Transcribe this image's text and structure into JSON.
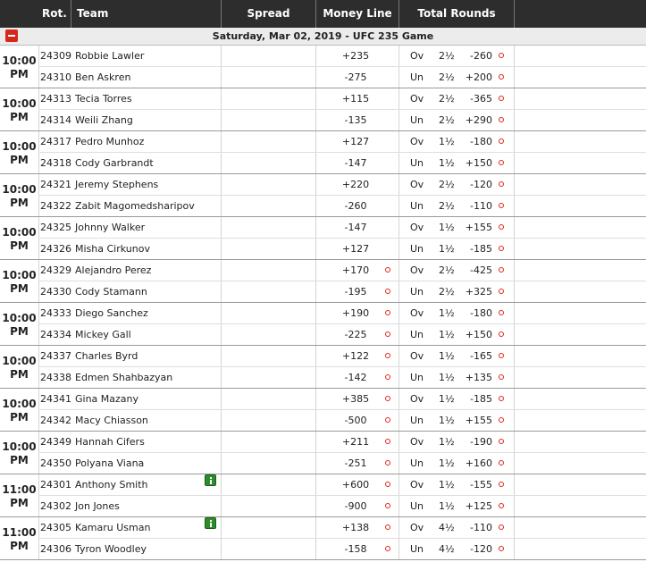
{
  "header": {
    "rot": "Rot.",
    "team": "Team",
    "spread": "Spread",
    "moneyline": "Money Line",
    "total": "Total Rounds"
  },
  "event_title": "Saturday, Mar 02, 2019 - UFC 235 Game",
  "colors": {
    "header_bg": "#2d2d2d",
    "date_band_bg": "#ececec",
    "accent_red": "#e0261a",
    "info_green": "#2e8c2e"
  },
  "icons": {
    "collapse": "minus-square-icon",
    "bet": "circle-bet-icon",
    "info": "info-icon"
  },
  "games": [
    {
      "time": [
        "10:00",
        "PM"
      ],
      "info": false,
      "ml_clickable": false,
      "fighters": [
        {
          "rot": "24309",
          "name": "Robbie Lawler",
          "ml": "+235",
          "ou": "Ov",
          "total": "2½",
          "odds": "-260"
        },
        {
          "rot": "24310",
          "name": "Ben Askren",
          "ml": "-275",
          "ou": "Un",
          "total": "2½",
          "odds": "+200"
        }
      ]
    },
    {
      "time": [
        "10:00",
        "PM"
      ],
      "info": false,
      "ml_clickable": false,
      "fighters": [
        {
          "rot": "24313",
          "name": "Tecia Torres",
          "ml": "+115",
          "ou": "Ov",
          "total": "2½",
          "odds": "-365"
        },
        {
          "rot": "24314",
          "name": "Weili Zhang",
          "ml": "-135",
          "ou": "Un",
          "total": "2½",
          "odds": "+290"
        }
      ]
    },
    {
      "time": [
        "10:00",
        "PM"
      ],
      "info": false,
      "ml_clickable": false,
      "fighters": [
        {
          "rot": "24317",
          "name": "Pedro Munhoz",
          "ml": "+127",
          "ou": "Ov",
          "total": "1½",
          "odds": "-180"
        },
        {
          "rot": "24318",
          "name": "Cody Garbrandt",
          "ml": "-147",
          "ou": "Un",
          "total": "1½",
          "odds": "+150"
        }
      ]
    },
    {
      "time": [
        "10:00",
        "PM"
      ],
      "info": false,
      "ml_clickable": false,
      "fighters": [
        {
          "rot": "24321",
          "name": "Jeremy Stephens",
          "ml": "+220",
          "ou": "Ov",
          "total": "2½",
          "odds": "-120"
        },
        {
          "rot": "24322",
          "name": "Zabit Magomedsharipov",
          "ml": "-260",
          "ou": "Un",
          "total": "2½",
          "odds": "-110"
        }
      ]
    },
    {
      "time": [
        "10:00",
        "PM"
      ],
      "info": false,
      "ml_clickable": false,
      "fighters": [
        {
          "rot": "24325",
          "name": "Johnny Walker",
          "ml": "-147",
          "ou": "Ov",
          "total": "1½",
          "odds": "+155"
        },
        {
          "rot": "24326",
          "name": "Misha Cirkunov",
          "ml": "+127",
          "ou": "Un",
          "total": "1½",
          "odds": "-185"
        }
      ]
    },
    {
      "time": [
        "10:00",
        "PM"
      ],
      "info": false,
      "ml_clickable": true,
      "fighters": [
        {
          "rot": "24329",
          "name": "Alejandro Perez",
          "ml": "+170",
          "ou": "Ov",
          "total": "2½",
          "odds": "-425"
        },
        {
          "rot": "24330",
          "name": "Cody Stamann",
          "ml": "-195",
          "ou": "Un",
          "total": "2½",
          "odds": "+325"
        }
      ]
    },
    {
      "time": [
        "10:00",
        "PM"
      ],
      "info": false,
      "ml_clickable": true,
      "fighters": [
        {
          "rot": "24333",
          "name": "Diego Sanchez",
          "ml": "+190",
          "ou": "Ov",
          "total": "1½",
          "odds": "-180"
        },
        {
          "rot": "24334",
          "name": "Mickey Gall",
          "ml": "-225",
          "ou": "Un",
          "total": "1½",
          "odds": "+150"
        }
      ]
    },
    {
      "time": [
        "10:00",
        "PM"
      ],
      "info": false,
      "ml_clickable": true,
      "fighters": [
        {
          "rot": "24337",
          "name": "Charles Byrd",
          "ml": "+122",
          "ou": "Ov",
          "total": "1½",
          "odds": "-165"
        },
        {
          "rot": "24338",
          "name": "Edmen Shahbazyan",
          "ml": "-142",
          "ou": "Un",
          "total": "1½",
          "odds": "+135"
        }
      ]
    },
    {
      "time": [
        "10:00",
        "PM"
      ],
      "info": false,
      "ml_clickable": true,
      "fighters": [
        {
          "rot": "24341",
          "name": "Gina Mazany",
          "ml": "+385",
          "ou": "Ov",
          "total": "1½",
          "odds": "-185"
        },
        {
          "rot": "24342",
          "name": "Macy Chiasson",
          "ml": "-500",
          "ou": "Un",
          "total": "1½",
          "odds": "+155"
        }
      ]
    },
    {
      "time": [
        "10:00",
        "PM"
      ],
      "info": false,
      "ml_clickable": true,
      "fighters": [
        {
          "rot": "24349",
          "name": "Hannah Cifers",
          "ml": "+211",
          "ou": "Ov",
          "total": "1½",
          "odds": "-190"
        },
        {
          "rot": "24350",
          "name": "Polyana Viana",
          "ml": "-251",
          "ou": "Un",
          "total": "1½",
          "odds": "+160"
        }
      ]
    },
    {
      "time": [
        "11:00",
        "PM"
      ],
      "info": true,
      "ml_clickable": true,
      "fighters": [
        {
          "rot": "24301",
          "name": "Anthony Smith",
          "ml": "+600",
          "ou": "Ov",
          "total": "1½",
          "odds": "-155"
        },
        {
          "rot": "24302",
          "name": "Jon Jones",
          "ml": "-900",
          "ou": "Un",
          "total": "1½",
          "odds": "+125"
        }
      ]
    },
    {
      "time": [
        "11:00",
        "PM"
      ],
      "info": true,
      "ml_clickable": true,
      "fighters": [
        {
          "rot": "24305",
          "name": "Kamaru Usman",
          "ml": "+138",
          "ou": "Ov",
          "total": "4½",
          "odds": "-110"
        },
        {
          "rot": "24306",
          "name": "Tyron Woodley",
          "ml": "-158",
          "ou": "Un",
          "total": "4½",
          "odds": "-120"
        }
      ]
    }
  ]
}
